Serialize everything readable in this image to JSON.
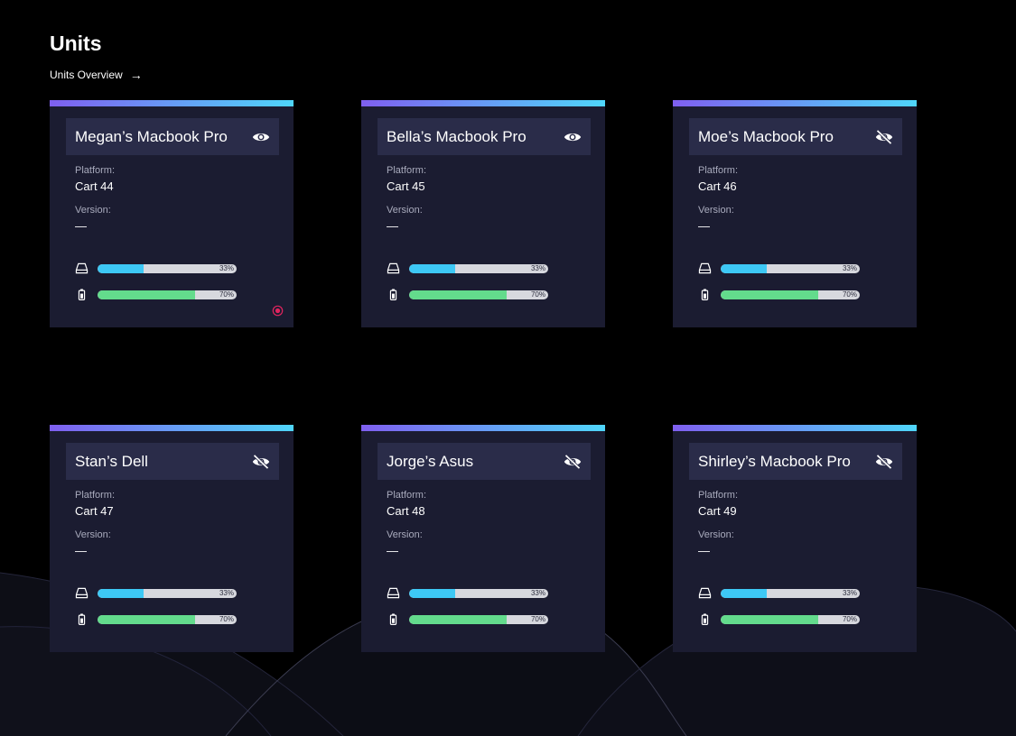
{
  "page": {
    "title": "Units",
    "overview_link": "Units Overview",
    "overview_arrow": "→"
  },
  "colors": {
    "background": "#000000",
    "card_background": "#1b1c31",
    "card_header": "#2a2c49",
    "gradient_start": "#7f5ff0",
    "gradient_end": "#4fd6fa",
    "storage_fill": "#3dc8f5",
    "battery_fill": "#63db8c",
    "track": "#d7d8de",
    "status_alert": "#e0245e"
  },
  "units": [
    {
      "name": "Megan’s Macbook Pro",
      "visibility_icon": "eye-icon",
      "platform_label": "Platform:",
      "platform": "Cart 44",
      "version_label": "Version:",
      "version": "—",
      "storage": {
        "icon": "hard-drive-icon",
        "percent": 33,
        "label": "33%"
      },
      "battery": {
        "icon": "battery-icon",
        "percent": 70,
        "label": "70%"
      },
      "status_icon": "record-icon"
    },
    {
      "name": "Bella’s Macbook Pro",
      "visibility_icon": "eye-icon",
      "platform_label": "Platform:",
      "platform": "Cart 45",
      "version_label": "Version:",
      "version": "—",
      "storage": {
        "icon": "hard-drive-icon",
        "percent": 33,
        "label": "33%"
      },
      "battery": {
        "icon": "battery-icon",
        "percent": 70,
        "label": "70%"
      }
    },
    {
      "name": "Moe’s Macbook Pro",
      "visibility_icon": "eye-off-icon",
      "platform_label": "Platform:",
      "platform": "Cart 46",
      "version_label": "Version:",
      "version": "—",
      "storage": {
        "icon": "hard-drive-icon",
        "percent": 33,
        "label": "33%"
      },
      "battery": {
        "icon": "battery-icon",
        "percent": 70,
        "label": "70%"
      }
    },
    {
      "name": "Stan’s Dell",
      "visibility_icon": "eye-off-icon",
      "platform_label": "Platform:",
      "platform": "Cart 47",
      "version_label": "Version:",
      "version": "—",
      "storage": {
        "icon": "hard-drive-icon",
        "percent": 33,
        "label": "33%"
      },
      "battery": {
        "icon": "battery-icon",
        "percent": 70,
        "label": "70%"
      }
    },
    {
      "name": "Jorge’s Asus",
      "visibility_icon": "eye-off-icon",
      "platform_label": "Platform:",
      "platform": "Cart 48",
      "version_label": "Version:",
      "version": "—",
      "storage": {
        "icon": "hard-drive-icon",
        "percent": 33,
        "label": "33%"
      },
      "battery": {
        "icon": "battery-icon",
        "percent": 70,
        "label": "70%"
      }
    },
    {
      "name": "Shirley’s Macbook Pro",
      "visibility_icon": "eye-off-icon",
      "platform_label": "Platform:",
      "platform": "Cart 49",
      "version_label": "Version:",
      "version": "—",
      "storage": {
        "icon": "hard-drive-icon",
        "percent": 33,
        "label": "33%"
      },
      "battery": {
        "icon": "battery-icon",
        "percent": 70,
        "label": "70%"
      }
    }
  ]
}
